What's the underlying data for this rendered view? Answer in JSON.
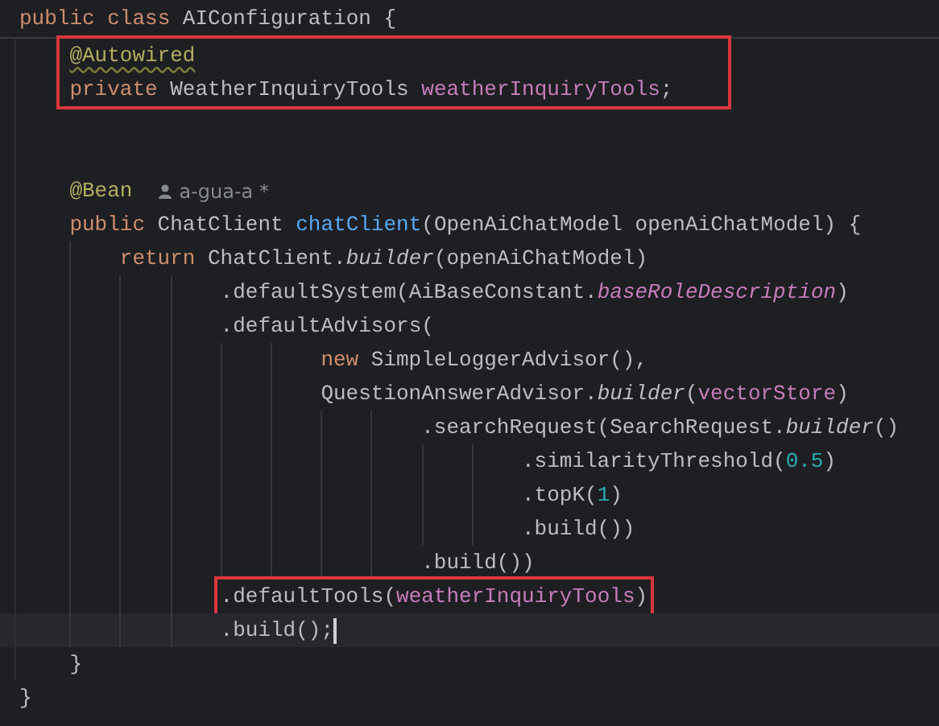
{
  "editor": {
    "lines": [
      {
        "kind": "code",
        "sticky": true,
        "tokens": [
          {
            "text": "public class ",
            "kind": "keyword"
          },
          {
            "text": "AIConfiguration {",
            "kind": "plain"
          }
        ]
      },
      {
        "kind": "code",
        "boxed": true,
        "tokens": [
          {
            "text": "    @Autowired",
            "kind": "annotation",
            "warning": true
          }
        ]
      },
      {
        "kind": "code",
        "boxed": true,
        "tokens": [
          {
            "text": "    private ",
            "kind": "keyword"
          },
          {
            "text": "WeatherInquiryTools ",
            "kind": "plain"
          },
          {
            "text": "weatherInquiryTools",
            "kind": "field"
          },
          {
            "text": ";",
            "kind": "plain"
          }
        ]
      },
      {
        "kind": "blank"
      },
      {
        "kind": "blank"
      },
      {
        "kind": "code",
        "tokens": [
          {
            "text": "    @Bean",
            "kind": "annotation"
          },
          {
            "text": "a-gua-a *",
            "kind": "author"
          }
        ]
      },
      {
        "kind": "code",
        "tokens": [
          {
            "text": "    public ",
            "kind": "keyword"
          },
          {
            "text": "ChatClient ",
            "kind": "plain"
          },
          {
            "text": "chatClient",
            "kind": "method"
          },
          {
            "text": "(OpenAiChatModel openAiChatModel) {",
            "kind": "plain"
          }
        ]
      },
      {
        "kind": "code",
        "tokens": [
          {
            "text": "        return ",
            "kind": "keyword"
          },
          {
            "text": "ChatClient.",
            "kind": "plain"
          },
          {
            "text": "builder",
            "kind": "static"
          },
          {
            "text": "(openAiChatModel)",
            "kind": "plain"
          }
        ]
      },
      {
        "kind": "code",
        "tokens": [
          {
            "text": "                .defaultSystem(AiBaseConstant.",
            "kind": "plain"
          },
          {
            "text": "baseRoleDescription",
            "kind": "static_field"
          },
          {
            "text": ")",
            "kind": "plain"
          }
        ]
      },
      {
        "kind": "code",
        "tokens": [
          {
            "text": "                .defaultAdvisors(",
            "kind": "plain"
          }
        ]
      },
      {
        "kind": "code",
        "tokens": [
          {
            "text": "                        new ",
            "kind": "keyword"
          },
          {
            "text": "SimpleLoggerAdvisor(),",
            "kind": "plain"
          }
        ]
      },
      {
        "kind": "code",
        "tokens": [
          {
            "text": "                        QuestionAnswerAdvisor.",
            "kind": "plain"
          },
          {
            "text": "builder",
            "kind": "static"
          },
          {
            "text": "(",
            "kind": "plain"
          },
          {
            "text": "vectorStore",
            "kind": "field"
          },
          {
            "text": ")",
            "kind": "plain"
          }
        ]
      },
      {
        "kind": "code",
        "tokens": [
          {
            "text": "                                .searchRequest(SearchRequest.",
            "kind": "plain"
          },
          {
            "text": "builder",
            "kind": "static"
          },
          {
            "text": "()",
            "kind": "plain"
          }
        ]
      },
      {
        "kind": "code",
        "tokens": [
          {
            "text": "                                        .similarityThreshold(",
            "kind": "plain"
          },
          {
            "text": "0.5",
            "kind": "number"
          },
          {
            "text": ")",
            "kind": "plain"
          }
        ]
      },
      {
        "kind": "code",
        "tokens": [
          {
            "text": "                                        .topK(",
            "kind": "plain"
          },
          {
            "text": "1",
            "kind": "number"
          },
          {
            "text": ")",
            "kind": "plain"
          }
        ]
      },
      {
        "kind": "code",
        "tokens": [
          {
            "text": "                                        .build())",
            "kind": "plain"
          }
        ]
      },
      {
        "kind": "code",
        "tokens": [
          {
            "text": "                                .build())",
            "kind": "plain"
          }
        ]
      },
      {
        "kind": "code",
        "boxed": true,
        "tokens": [
          {
            "text": "                .defaultTools(",
            "kind": "plain"
          },
          {
            "text": "weatherInquiryTools",
            "kind": "field"
          },
          {
            "text": ")",
            "kind": "plain"
          }
        ]
      },
      {
        "kind": "code",
        "current": true,
        "tokens": [
          {
            "text": "                .build();",
            "kind": "plain"
          }
        ]
      },
      {
        "kind": "code",
        "tokens": [
          {
            "text": "    }",
            "kind": "plain"
          }
        ]
      },
      {
        "kind": "code",
        "tokens": [
          {
            "text": "}",
            "kind": "plain"
          }
        ]
      }
    ]
  }
}
